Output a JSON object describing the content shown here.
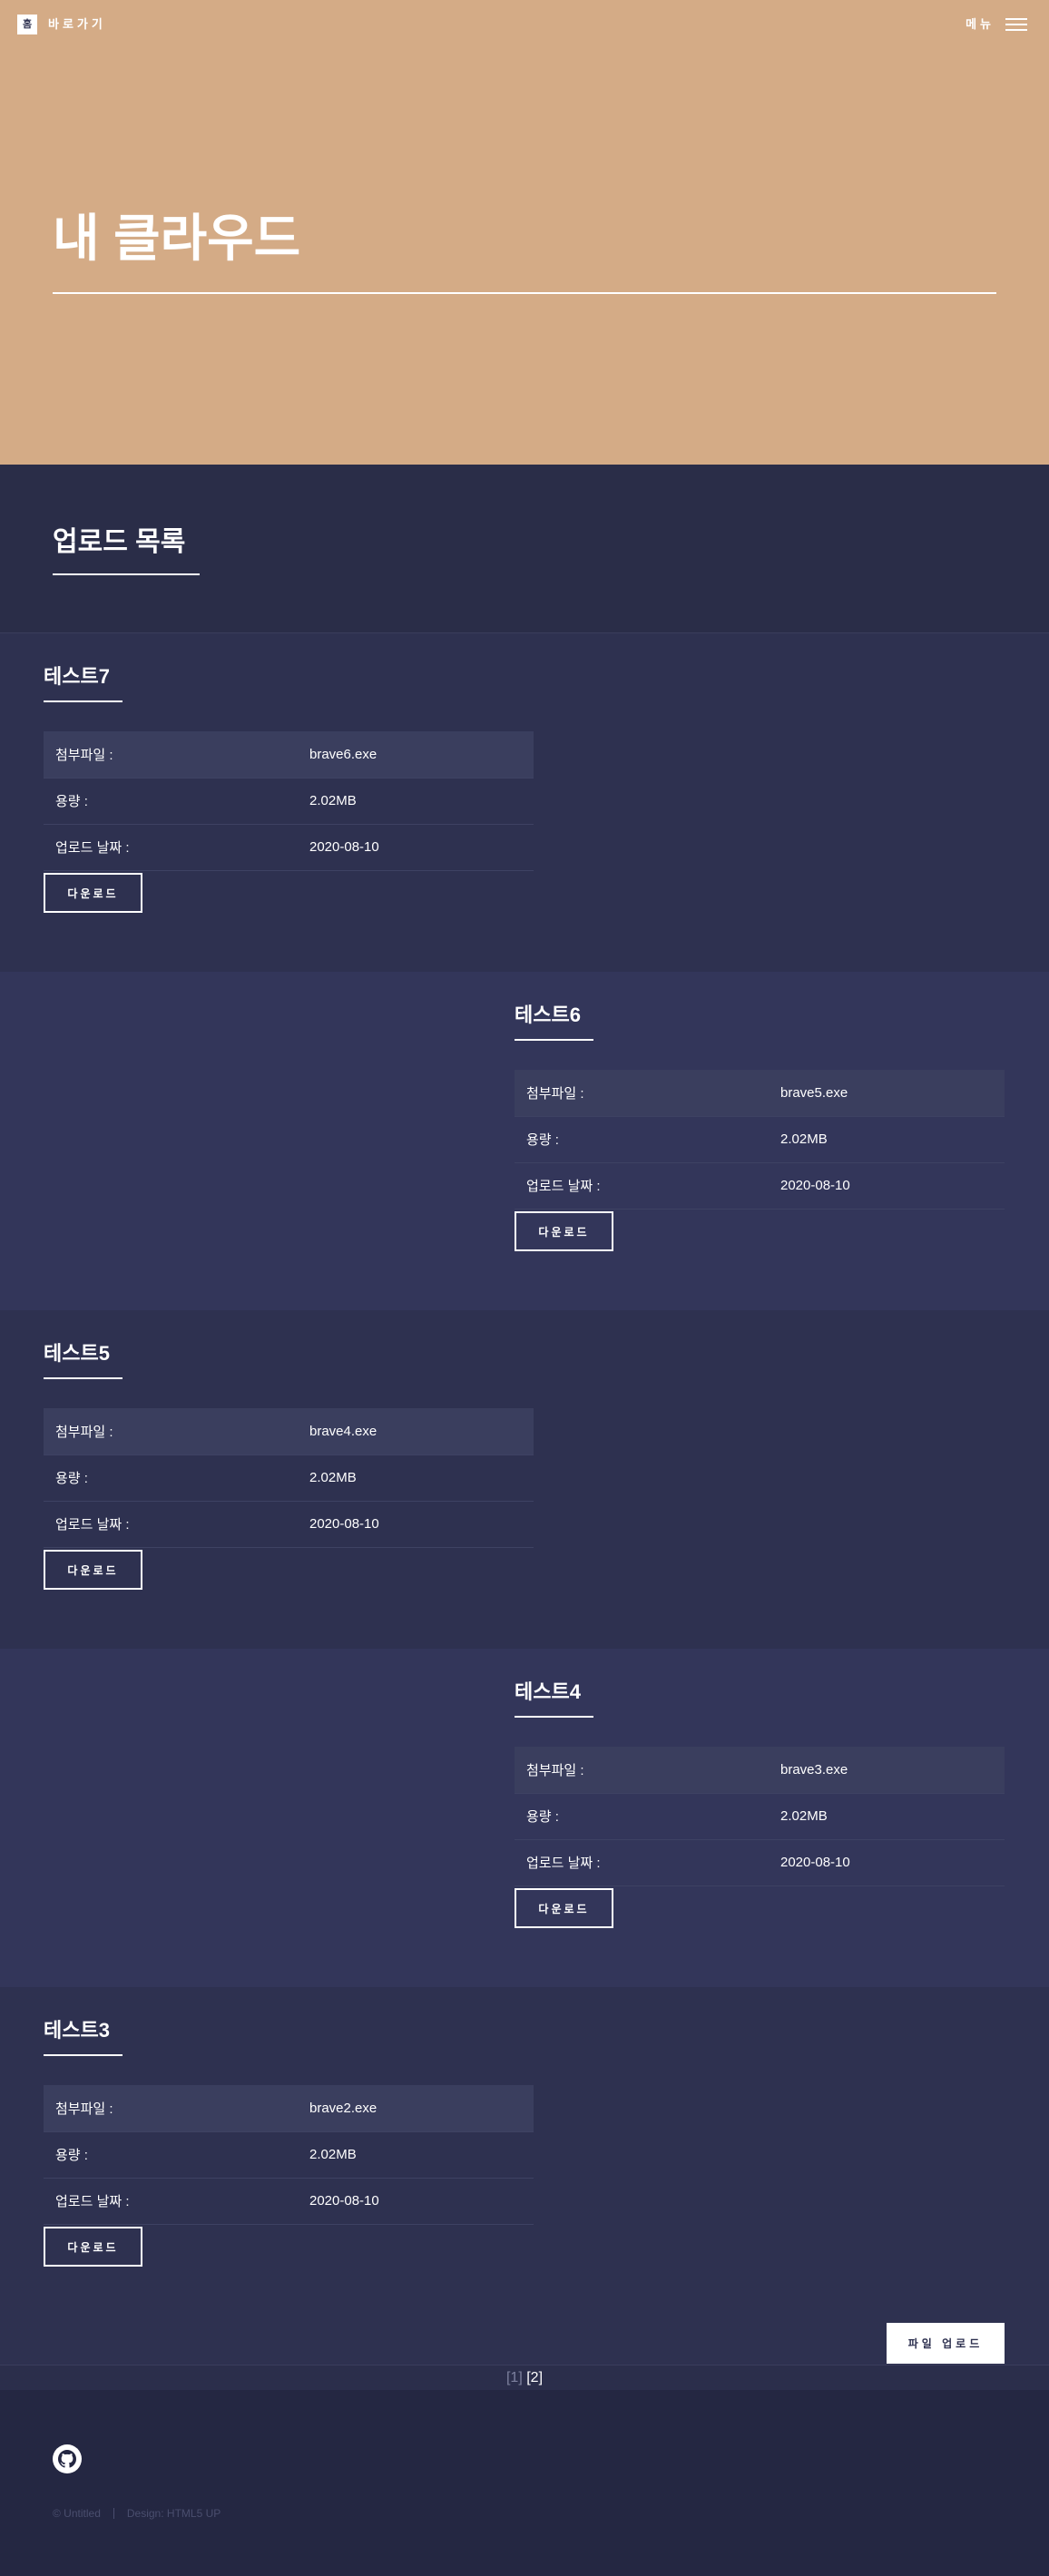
{
  "header": {
    "logo_glyph": "홈",
    "home_label": "바로가기",
    "menu_label": "메뉴"
  },
  "banner": {
    "title": "내 클라우드"
  },
  "section": {
    "title": "업로드 목록"
  },
  "posts": [
    {
      "title": "테스트7",
      "rows": [
        {
          "label": "첨부파일 :",
          "value": "brave6.exe"
        },
        {
          "label": "용량 :",
          "value": "2.02MB"
        },
        {
          "label": "업로드 날짜 :",
          "value": "2020-08-10"
        }
      ],
      "button": "다운로드"
    },
    {
      "title": "테스트6",
      "rows": [
        {
          "label": "첨부파일 :",
          "value": "brave5.exe"
        },
        {
          "label": "용량 :",
          "value": "2.02MB"
        },
        {
          "label": "업로드 날짜 :",
          "value": "2020-08-10"
        }
      ],
      "button": "다운로드"
    },
    {
      "title": "테스트5",
      "rows": [
        {
          "label": "첨부파일 :",
          "value": "brave4.exe"
        },
        {
          "label": "용량 :",
          "value": "2.02MB"
        },
        {
          "label": "업로드 날짜 :",
          "value": "2020-08-10"
        }
      ],
      "button": "다운로드"
    },
    {
      "title": "테스트4",
      "rows": [
        {
          "label": "첨부파일 :",
          "value": "brave3.exe"
        },
        {
          "label": "용량 :",
          "value": "2.02MB"
        },
        {
          "label": "업로드 날짜 :",
          "value": "2020-08-10"
        }
      ],
      "button": "다운로드"
    },
    {
      "title": "테스트3",
      "rows": [
        {
          "label": "첨부파일 :",
          "value": "brave2.exe"
        },
        {
          "label": "용량 :",
          "value": "2.02MB"
        },
        {
          "label": "업로드 날짜 :",
          "value": "2020-08-10"
        }
      ],
      "button": "다운로드"
    }
  ],
  "upload_button": "파일 업로드",
  "pagination": {
    "page1": "[1]",
    "page2": "[2]"
  },
  "footer": {
    "copyright": "© Untitled",
    "design": "Design: HTML5 UP",
    "github_icon": "github-icon"
  },
  "colors": {
    "banner": "#d4ab86",
    "section_bg": "#2a2d48",
    "row_bg_1": "#2e3150",
    "row_bg_2": "#33365a",
    "footer_bg": "#242742"
  }
}
